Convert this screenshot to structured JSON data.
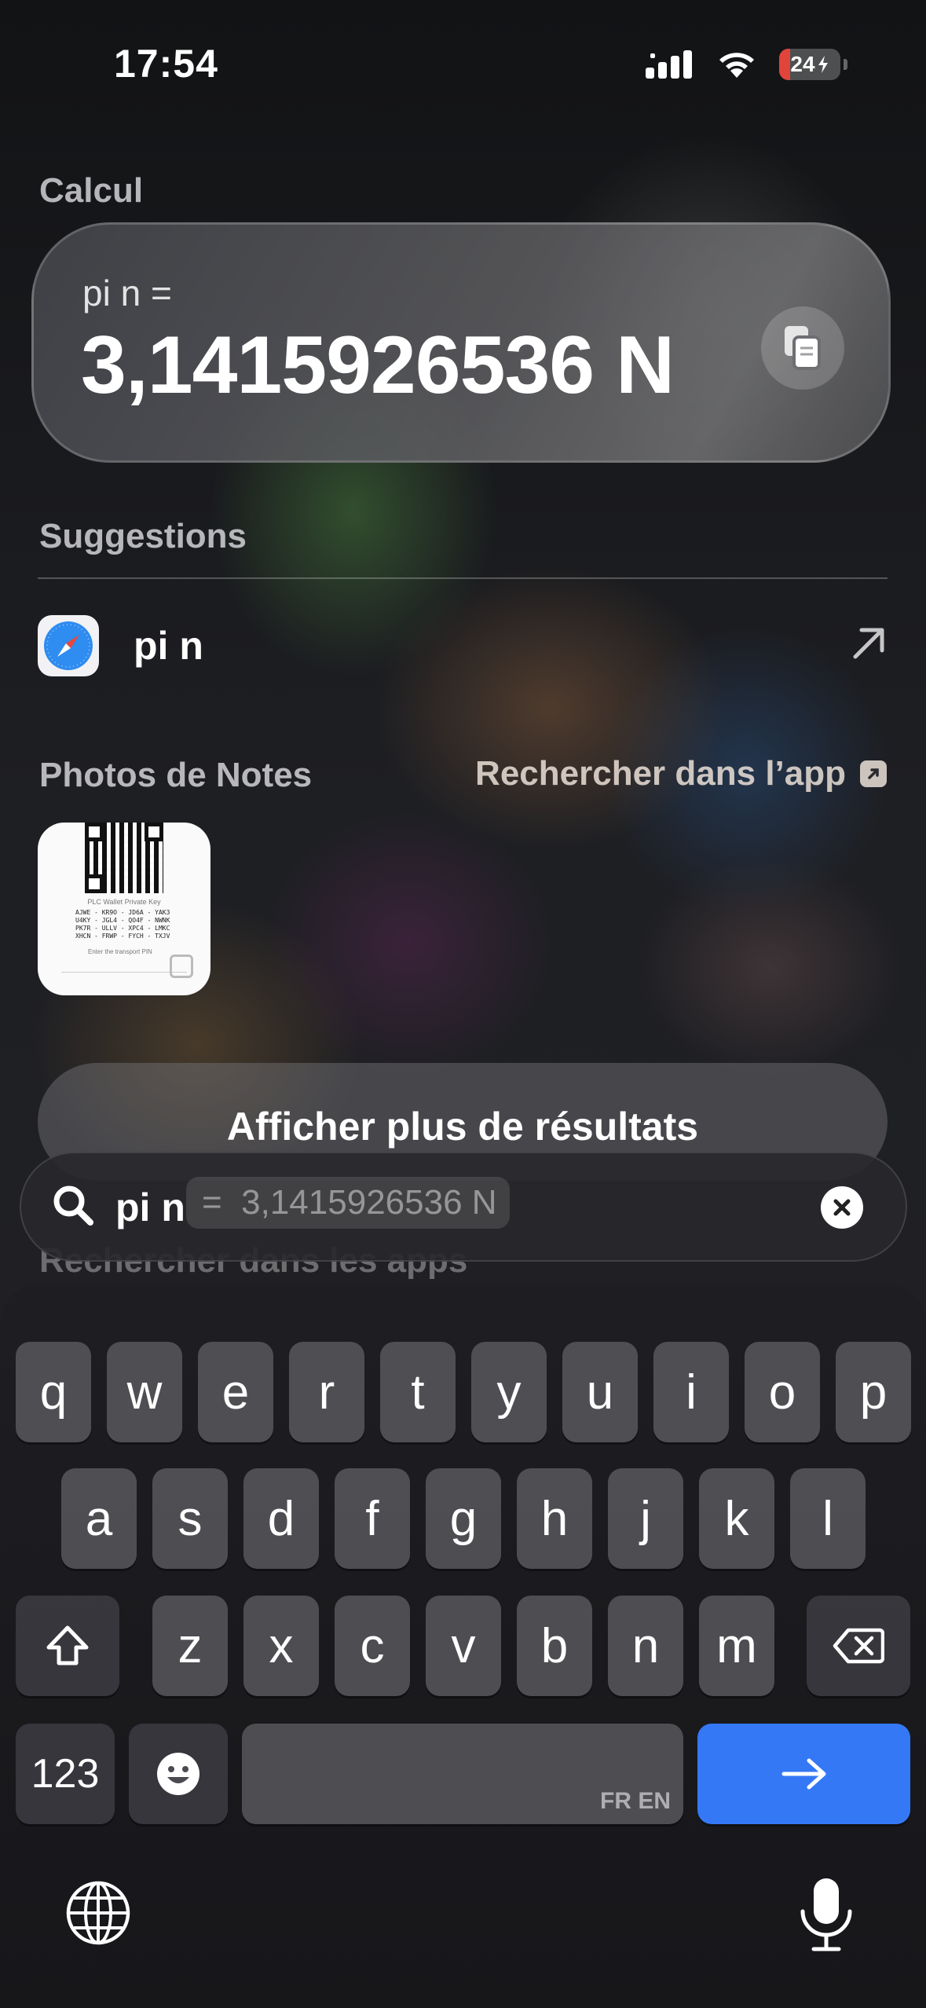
{
  "status_bar": {
    "time": "17:54",
    "battery": "24"
  },
  "calc": {
    "section_title": "Calcul",
    "expression": "pi n =",
    "result": "3,1415926536 N"
  },
  "suggestions": {
    "title": "Suggestions",
    "items": [
      {
        "label": "pi n",
        "app": "Safari"
      }
    ]
  },
  "photos": {
    "title": "Photos de Notes",
    "search_in_app": "Rechercher dans l’app",
    "thumbnail": {
      "heading": "PLC Wallet Private Key",
      "lines": [
        "AJWE - KR9O - JD6A - YAK3",
        "U4KY - JGL4 - QO4F - NWNK",
        "PK7R - ULLV - XPC4 - LMKC",
        "XHCN - FRWP - FYCH - TXJV"
      ],
      "footer": "Enter the transport PIN"
    }
  },
  "more_results": "Afficher plus de résultats",
  "search_in_apps": "Rechercher dans les apps",
  "search": {
    "query": "pi n",
    "completion": "=  3,1415926536 N"
  },
  "keyboard": {
    "row1": [
      "q",
      "w",
      "e",
      "r",
      "t",
      "y",
      "u",
      "i",
      "o",
      "p"
    ],
    "row2": [
      "a",
      "s",
      "d",
      "f",
      "g",
      "h",
      "j",
      "k",
      "l"
    ],
    "row3": [
      "z",
      "x",
      "c",
      "v",
      "b",
      "n",
      "m"
    ],
    "numbers_key": "123",
    "space_lang": "FR EN"
  },
  "colors": {
    "accent": "#3478f6",
    "battery_low": "#e0443b"
  }
}
